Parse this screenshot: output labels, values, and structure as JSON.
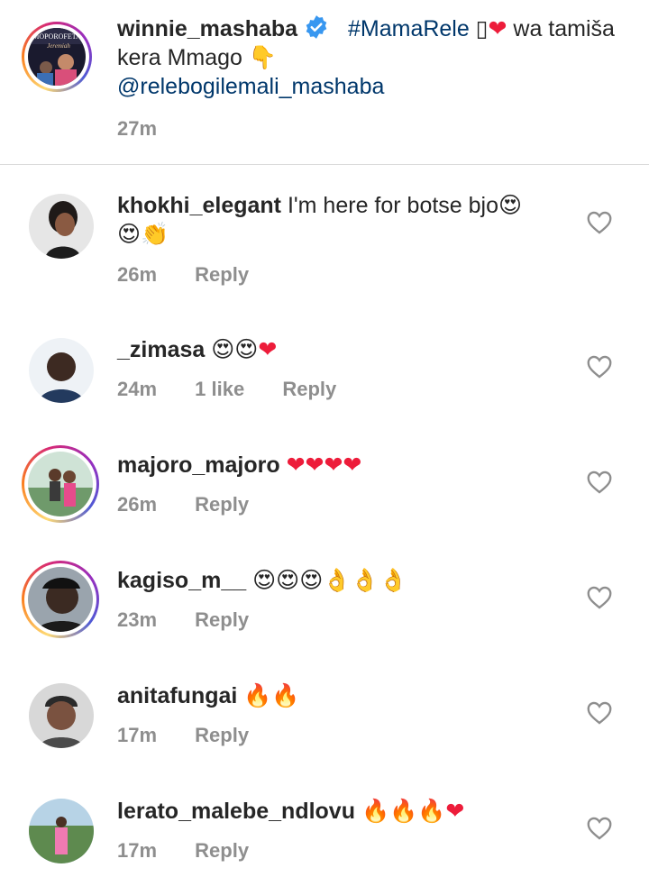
{
  "caption": {
    "username": "winnie_mashaba",
    "hashtag": "#MamaRele",
    "glyph": "▯",
    "text_after": " wa tamiša kera Mmago ",
    "emoji_point": "👇",
    "mention": "@relebogilemali_mashaba",
    "time": "27m",
    "avatar_text_line1": "MOPOROFETA",
    "avatar_text_line2": "Jeremiah"
  },
  "comments": [
    {
      "username": "khokhi_elegant",
      "text": " I'm here for botse bjo",
      "emojis": "😍",
      "emojis_line2": "😍👏",
      "time": "26m",
      "likes": "",
      "reply": "Reply"
    },
    {
      "username": "_zimasa",
      "text": " ",
      "emojis": "😍😍",
      "hearts": "❤",
      "time": "24m",
      "likes": "1 like",
      "reply": "Reply"
    },
    {
      "username": "majoro_majoro",
      "text": " ",
      "hearts": "❤❤❤❤",
      "time": "26m",
      "likes": "",
      "reply": "Reply"
    },
    {
      "username": "kagiso_m__",
      "text": " ",
      "emojis": "😍😍😍👌👌👌",
      "time": "23m",
      "likes": "",
      "reply": "Reply"
    },
    {
      "username": "anitafungai",
      "text": " ",
      "emojis": "🔥🔥",
      "time": "17m",
      "likes": "",
      "reply": "Reply"
    },
    {
      "username": "lerato_malebe_ndlovu",
      "text": " ",
      "emojis": "🔥🔥🔥",
      "hearts": "❤",
      "time": "17m",
      "likes": "",
      "reply": "Reply"
    }
  ],
  "colors": {
    "link": "#00376b",
    "meta": "#8e8e8e",
    "heart": "#ed1c3a",
    "verified": "#3897f0"
  },
  "icons": {
    "like": "heart-outline-icon",
    "verified": "verified-badge-icon"
  }
}
